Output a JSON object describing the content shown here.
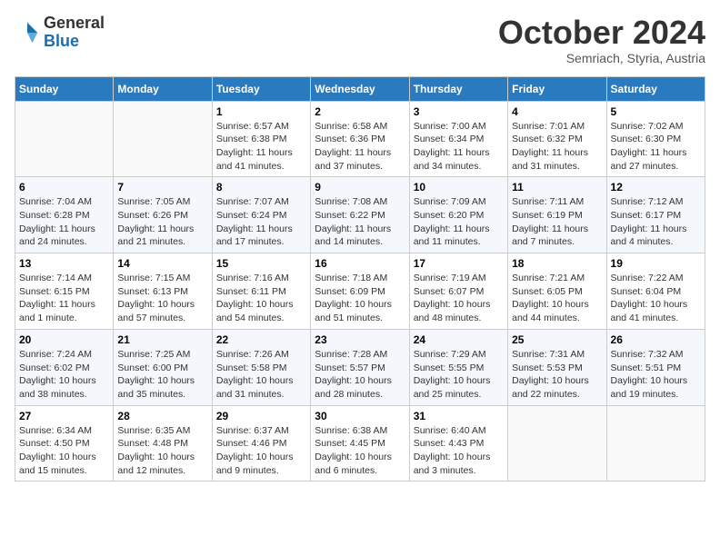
{
  "logo": {
    "general": "General",
    "blue": "Blue"
  },
  "header": {
    "month": "October 2024",
    "location": "Semriach, Styria, Austria"
  },
  "weekdays": [
    "Sunday",
    "Monday",
    "Tuesday",
    "Wednesday",
    "Thursday",
    "Friday",
    "Saturday"
  ],
  "weeks": [
    [
      {
        "day": "",
        "sunrise": "",
        "sunset": "",
        "daylight": ""
      },
      {
        "day": "",
        "sunrise": "",
        "sunset": "",
        "daylight": ""
      },
      {
        "day": "1",
        "sunrise": "Sunrise: 6:57 AM",
        "sunset": "Sunset: 6:38 PM",
        "daylight": "Daylight: 11 hours and 41 minutes."
      },
      {
        "day": "2",
        "sunrise": "Sunrise: 6:58 AM",
        "sunset": "Sunset: 6:36 PM",
        "daylight": "Daylight: 11 hours and 37 minutes."
      },
      {
        "day": "3",
        "sunrise": "Sunrise: 7:00 AM",
        "sunset": "Sunset: 6:34 PM",
        "daylight": "Daylight: 11 hours and 34 minutes."
      },
      {
        "day": "4",
        "sunrise": "Sunrise: 7:01 AM",
        "sunset": "Sunset: 6:32 PM",
        "daylight": "Daylight: 11 hours and 31 minutes."
      },
      {
        "day": "5",
        "sunrise": "Sunrise: 7:02 AM",
        "sunset": "Sunset: 6:30 PM",
        "daylight": "Daylight: 11 hours and 27 minutes."
      }
    ],
    [
      {
        "day": "6",
        "sunrise": "Sunrise: 7:04 AM",
        "sunset": "Sunset: 6:28 PM",
        "daylight": "Daylight: 11 hours and 24 minutes."
      },
      {
        "day": "7",
        "sunrise": "Sunrise: 7:05 AM",
        "sunset": "Sunset: 6:26 PM",
        "daylight": "Daylight: 11 hours and 21 minutes."
      },
      {
        "day": "8",
        "sunrise": "Sunrise: 7:07 AM",
        "sunset": "Sunset: 6:24 PM",
        "daylight": "Daylight: 11 hours and 17 minutes."
      },
      {
        "day": "9",
        "sunrise": "Sunrise: 7:08 AM",
        "sunset": "Sunset: 6:22 PM",
        "daylight": "Daylight: 11 hours and 14 minutes."
      },
      {
        "day": "10",
        "sunrise": "Sunrise: 7:09 AM",
        "sunset": "Sunset: 6:20 PM",
        "daylight": "Daylight: 11 hours and 11 minutes."
      },
      {
        "day": "11",
        "sunrise": "Sunrise: 7:11 AM",
        "sunset": "Sunset: 6:19 PM",
        "daylight": "Daylight: 11 hours and 7 minutes."
      },
      {
        "day": "12",
        "sunrise": "Sunrise: 7:12 AM",
        "sunset": "Sunset: 6:17 PM",
        "daylight": "Daylight: 11 hours and 4 minutes."
      }
    ],
    [
      {
        "day": "13",
        "sunrise": "Sunrise: 7:14 AM",
        "sunset": "Sunset: 6:15 PM",
        "daylight": "Daylight: 11 hours and 1 minute."
      },
      {
        "day": "14",
        "sunrise": "Sunrise: 7:15 AM",
        "sunset": "Sunset: 6:13 PM",
        "daylight": "Daylight: 10 hours and 57 minutes."
      },
      {
        "day": "15",
        "sunrise": "Sunrise: 7:16 AM",
        "sunset": "Sunset: 6:11 PM",
        "daylight": "Daylight: 10 hours and 54 minutes."
      },
      {
        "day": "16",
        "sunrise": "Sunrise: 7:18 AM",
        "sunset": "Sunset: 6:09 PM",
        "daylight": "Daylight: 10 hours and 51 minutes."
      },
      {
        "day": "17",
        "sunrise": "Sunrise: 7:19 AM",
        "sunset": "Sunset: 6:07 PM",
        "daylight": "Daylight: 10 hours and 48 minutes."
      },
      {
        "day": "18",
        "sunrise": "Sunrise: 7:21 AM",
        "sunset": "Sunset: 6:05 PM",
        "daylight": "Daylight: 10 hours and 44 minutes."
      },
      {
        "day": "19",
        "sunrise": "Sunrise: 7:22 AM",
        "sunset": "Sunset: 6:04 PM",
        "daylight": "Daylight: 10 hours and 41 minutes."
      }
    ],
    [
      {
        "day": "20",
        "sunrise": "Sunrise: 7:24 AM",
        "sunset": "Sunset: 6:02 PM",
        "daylight": "Daylight: 10 hours and 38 minutes."
      },
      {
        "day": "21",
        "sunrise": "Sunrise: 7:25 AM",
        "sunset": "Sunset: 6:00 PM",
        "daylight": "Daylight: 10 hours and 35 minutes."
      },
      {
        "day": "22",
        "sunrise": "Sunrise: 7:26 AM",
        "sunset": "Sunset: 5:58 PM",
        "daylight": "Daylight: 10 hours and 31 minutes."
      },
      {
        "day": "23",
        "sunrise": "Sunrise: 7:28 AM",
        "sunset": "Sunset: 5:57 PM",
        "daylight": "Daylight: 10 hours and 28 minutes."
      },
      {
        "day": "24",
        "sunrise": "Sunrise: 7:29 AM",
        "sunset": "Sunset: 5:55 PM",
        "daylight": "Daylight: 10 hours and 25 minutes."
      },
      {
        "day": "25",
        "sunrise": "Sunrise: 7:31 AM",
        "sunset": "Sunset: 5:53 PM",
        "daylight": "Daylight: 10 hours and 22 minutes."
      },
      {
        "day": "26",
        "sunrise": "Sunrise: 7:32 AM",
        "sunset": "Sunset: 5:51 PM",
        "daylight": "Daylight: 10 hours and 19 minutes."
      }
    ],
    [
      {
        "day": "27",
        "sunrise": "Sunrise: 6:34 AM",
        "sunset": "Sunset: 4:50 PM",
        "daylight": "Daylight: 10 hours and 15 minutes."
      },
      {
        "day": "28",
        "sunrise": "Sunrise: 6:35 AM",
        "sunset": "Sunset: 4:48 PM",
        "daylight": "Daylight: 10 hours and 12 minutes."
      },
      {
        "day": "29",
        "sunrise": "Sunrise: 6:37 AM",
        "sunset": "Sunset: 4:46 PM",
        "daylight": "Daylight: 10 hours and 9 minutes."
      },
      {
        "day": "30",
        "sunrise": "Sunrise: 6:38 AM",
        "sunset": "Sunset: 4:45 PM",
        "daylight": "Daylight: 10 hours and 6 minutes."
      },
      {
        "day": "31",
        "sunrise": "Sunrise: 6:40 AM",
        "sunset": "Sunset: 4:43 PM",
        "daylight": "Daylight: 10 hours and 3 minutes."
      },
      {
        "day": "",
        "sunrise": "",
        "sunset": "",
        "daylight": ""
      },
      {
        "day": "",
        "sunrise": "",
        "sunset": "",
        "daylight": ""
      }
    ]
  ]
}
